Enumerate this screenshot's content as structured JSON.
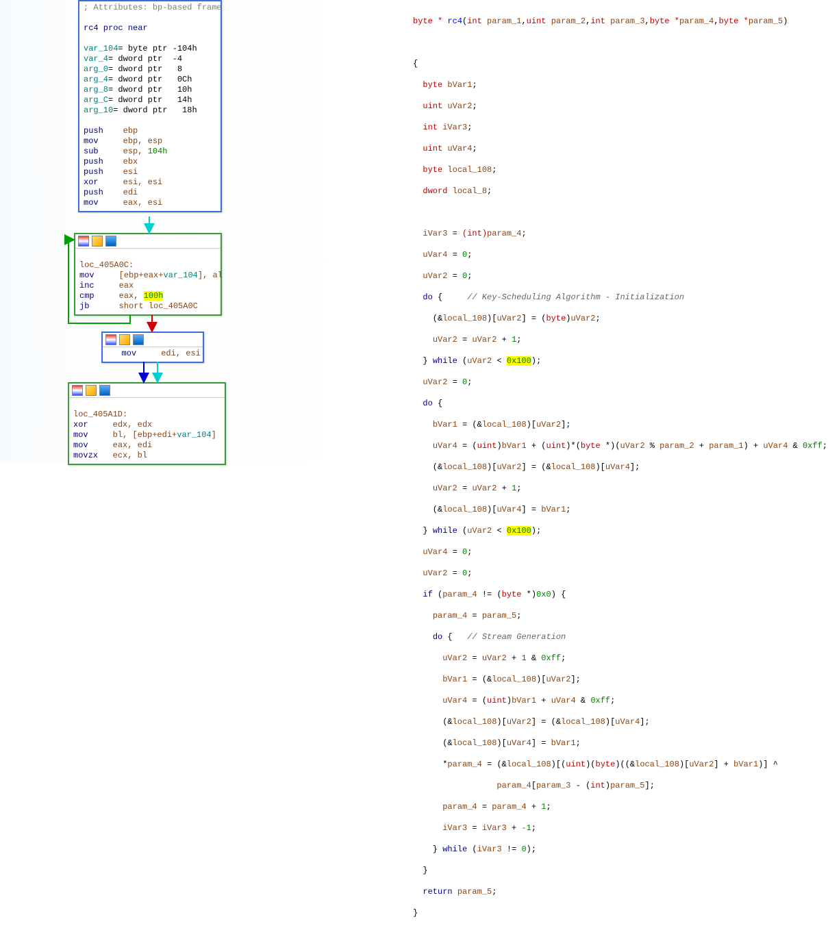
{
  "assembly": {
    "node1": {
      "comment": "; Attributes: bp-based frame",
      "proc": "rc4 proc near",
      "vars": [
        {
          "name": "var_104",
          "def": "= byte ptr -104h"
        },
        {
          "name": "var_4",
          "def": "= dword ptr  -4"
        },
        {
          "name": "arg_0",
          "def": "= dword ptr   8"
        },
        {
          "name": "arg_4",
          "def": "= dword ptr   0Ch"
        },
        {
          "name": "arg_8",
          "def": "= dword ptr   10h"
        },
        {
          "name": "arg_C",
          "def": "= dword ptr   14h"
        },
        {
          "name": "arg_10",
          "def": "= dword ptr   18h"
        }
      ],
      "instrs": [
        {
          "op": "push",
          "args": "ebp"
        },
        {
          "op": "mov",
          "args": "ebp, esp"
        },
        {
          "op": "sub",
          "args_a": "esp, ",
          "args_b": "104h"
        },
        {
          "op": "push",
          "args": "ebx"
        },
        {
          "op": "push",
          "args": "esi"
        },
        {
          "op": "xor",
          "args": "esi, esi"
        },
        {
          "op": "push",
          "args": "edi"
        },
        {
          "op": "mov",
          "args": "eax, esi"
        }
      ]
    },
    "node2": {
      "label": "loc_405A0C:",
      "l1_op": "mov",
      "l1_a": "[ebp+eax+",
      "l1_v": "var_104",
      "l1_b": "], al",
      "l2_op": "inc",
      "l2_args": "eax",
      "l3_op": "cmp",
      "l3_a": "eax, ",
      "l3_hl": "100h",
      "l4_op": "jb",
      "l4_args": "short loc_405A0C"
    },
    "node3": {
      "l1_op": "mov",
      "l1_args": "edi, esi"
    },
    "node4": {
      "label": "loc_405A1D:",
      "l1_op": "xor",
      "l1_args": "edx, edx",
      "l2_op": "mov",
      "l2_a": "bl, [ebp+edi+",
      "l2_v": "var_104",
      "l2_b": "]",
      "l3_op": "mov",
      "l3_args": "eax, edi",
      "l4_op": "movzx",
      "l4_args": "ecx, bl"
    }
  },
  "decompiled": {
    "sig_pre": "byte * ",
    "sig_fn": "rc4",
    "sig_p1": "int ",
    "sig_p1n": "param_1",
    "sig_p2": "uint ",
    "sig_p2n": "param_2",
    "sig_p3": "int ",
    "sig_p3n": "param_3",
    "sig_p4": "byte *",
    "sig_p4n": "param_4",
    "sig_p5": "byte *",
    "sig_p5n": "param_5",
    "decl_byte": "byte ",
    "decl_uint": "uint ",
    "decl_int": "int ",
    "decl_dword": "dword ",
    "v_bVar1": "bVar1",
    "v_uVar2": "uVar2",
    "v_iVar3": "iVar3",
    "v_uVar4": "uVar4",
    "v_local108": "local_108",
    "v_local8": "local_8",
    "l_cast_int": "(int)",
    "l_zero": "0",
    "l_one": "1",
    "l_negone": "-1",
    "l_0xff": "0xff",
    "l_0x100": "0x100",
    "l_0x0": "0x0",
    "comment_ksa": "// Key-Scheduling Algorithm - Initialization",
    "comment_stream": "// Stream Generation",
    "kw_do": "do",
    "kw_while": "while",
    "kw_if": "if",
    "kw_return": "return",
    "p1": "param_1",
    "p2": "param_2",
    "p3": "param_3",
    "p4": "param_4",
    "p5": "param_5"
  }
}
